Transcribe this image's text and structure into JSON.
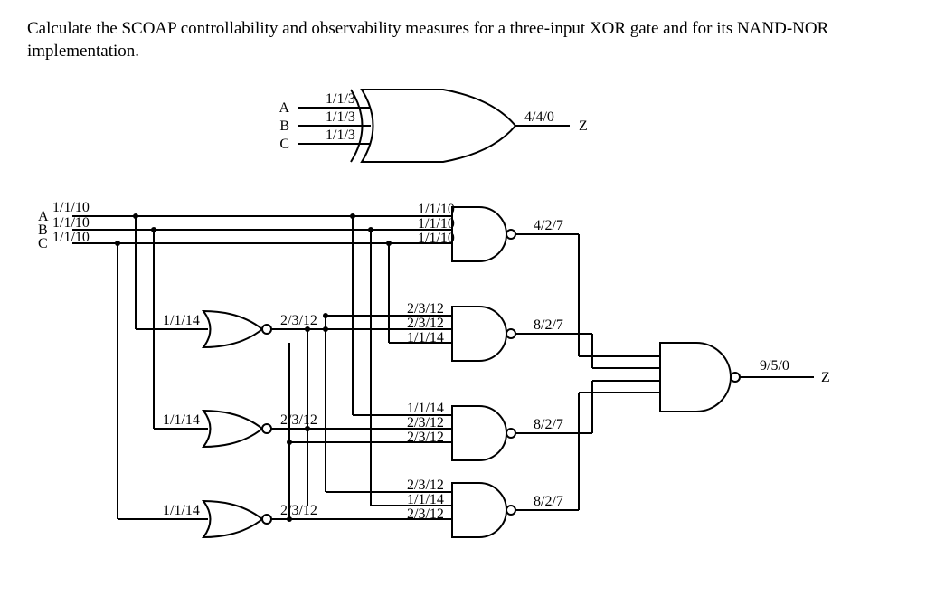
{
  "title": "Calculate the SCOAP controllability and observability measures for a three-input XOR gate and for its NAND-NOR implementation.",
  "xor": {
    "inA": {
      "name": "A",
      "scoap": "1/1/3"
    },
    "inB": {
      "name": "B",
      "scoap": "1/1/3"
    },
    "inC": {
      "name": "C",
      "scoap": "1/1/3"
    },
    "out": {
      "name": "Z",
      "scoap": "4/4/0"
    }
  },
  "impl": {
    "primaryInputs": {
      "A": {
        "name": "A",
        "scoap": "1/1/10"
      },
      "B": {
        "name": "B",
        "scoap": "1/1/10"
      },
      "C": {
        "name": "C",
        "scoap": "1/1/10"
      }
    },
    "nor1": {
      "in": "1/1/14",
      "out": "2/3/12"
    },
    "nor2": {
      "in": "1/1/14",
      "out": "2/3/12"
    },
    "nor3": {
      "in": "1/1/14",
      "out": "2/3/12"
    },
    "nand1": {
      "in1": "1/1/10",
      "in2": "1/1/10",
      "in3": "1/1/10",
      "out": "4/2/7"
    },
    "nand2": {
      "in1": "2/3/12",
      "in2": "2/3/12",
      "in3": "1/1/14",
      "out": "8/2/7"
    },
    "nand3": {
      "in1": "1/1/14",
      "in2": "2/3/12",
      "in3": "2/3/12",
      "out": "8/2/7"
    },
    "nand4": {
      "in1": "2/3/12",
      "in2": "1/1/14",
      "in3": "2/3/12",
      "out": "8/2/7"
    },
    "finalNand": {
      "out": "9/5/0",
      "name": "Z"
    }
  }
}
